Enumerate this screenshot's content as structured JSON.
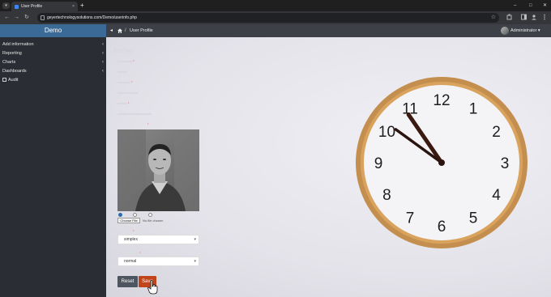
{
  "browser": {
    "tab_title": "User Profile",
    "tab_close": "×",
    "tab_menu": "▾",
    "new_tab": "+",
    "url": "geyertechnologysolutions.com/Demo/userinfo.php",
    "window_controls": [
      "–",
      "□",
      "✕"
    ],
    "nav": [
      "←",
      "→",
      "↻"
    ],
    "star": "☆"
  },
  "sidebar": {
    "brand": "Demo",
    "items": [
      {
        "label": "Add information",
        "chevron": "‹"
      },
      {
        "label": "Reporting",
        "chevron": "‹"
      },
      {
        "label": "Charts",
        "chevron": "‹"
      },
      {
        "label": "Dashboards",
        "chevron": "‹"
      },
      {
        "label": "Audit",
        "chevron": ""
      }
    ]
  },
  "topbar": {
    "toggle": "◂",
    "separator": "/",
    "breadcrumb": "User Profile",
    "user": "Administrator ▾"
  },
  "form": {
    "title": "Profile",
    "choose_file": "Choose File",
    "no_file": "No file chosen",
    "theme_value": "simplex",
    "mode_value": "normal",
    "reset": "Reset",
    "save": "Save"
  },
  "clock": {
    "numerals": [
      "12",
      "1",
      "2",
      "3",
      "4",
      "5",
      "6",
      "7",
      "8",
      "9",
      "10",
      "11"
    ],
    "time": "10:51"
  },
  "colors": {
    "accent_blue": "#3b6a96",
    "save_orange": "#c0451b",
    "sidebar_bg": "#2a2d33"
  }
}
